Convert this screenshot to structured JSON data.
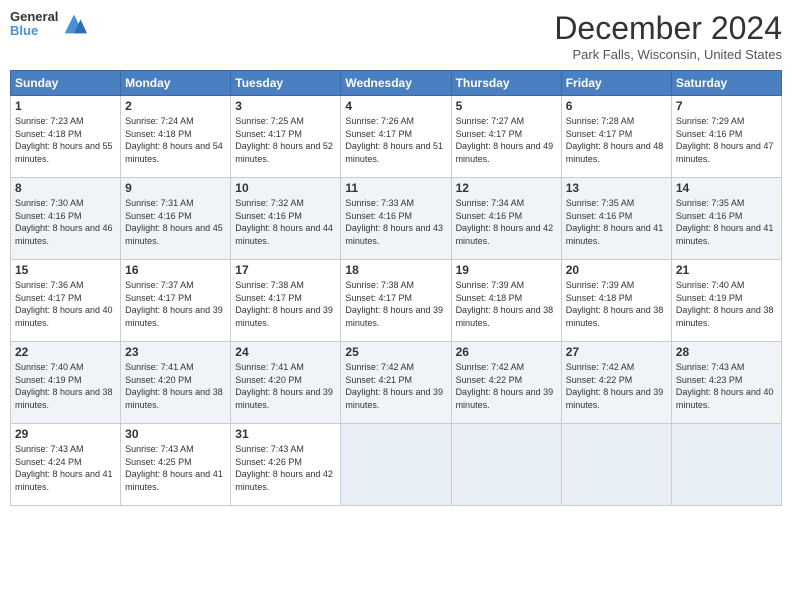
{
  "header": {
    "logo_line1": "General",
    "logo_line2": "Blue",
    "month": "December 2024",
    "location": "Park Falls, Wisconsin, United States"
  },
  "days_of_week": [
    "Sunday",
    "Monday",
    "Tuesday",
    "Wednesday",
    "Thursday",
    "Friday",
    "Saturday"
  ],
  "weeks": [
    [
      {
        "day": "1",
        "sunrise": "7:23 AM",
        "sunset": "4:18 PM",
        "daylight": "8 hours and 55 minutes."
      },
      {
        "day": "2",
        "sunrise": "7:24 AM",
        "sunset": "4:18 PM",
        "daylight": "8 hours and 54 minutes."
      },
      {
        "day": "3",
        "sunrise": "7:25 AM",
        "sunset": "4:17 PM",
        "daylight": "8 hours and 52 minutes."
      },
      {
        "day": "4",
        "sunrise": "7:26 AM",
        "sunset": "4:17 PM",
        "daylight": "8 hours and 51 minutes."
      },
      {
        "day": "5",
        "sunrise": "7:27 AM",
        "sunset": "4:17 PM",
        "daylight": "8 hours and 49 minutes."
      },
      {
        "day": "6",
        "sunrise": "7:28 AM",
        "sunset": "4:17 PM",
        "daylight": "8 hours and 48 minutes."
      },
      {
        "day": "7",
        "sunrise": "7:29 AM",
        "sunset": "4:16 PM",
        "daylight": "8 hours and 47 minutes."
      }
    ],
    [
      {
        "day": "8",
        "sunrise": "7:30 AM",
        "sunset": "4:16 PM",
        "daylight": "8 hours and 46 minutes."
      },
      {
        "day": "9",
        "sunrise": "7:31 AM",
        "sunset": "4:16 PM",
        "daylight": "8 hours and 45 minutes."
      },
      {
        "day": "10",
        "sunrise": "7:32 AM",
        "sunset": "4:16 PM",
        "daylight": "8 hours and 44 minutes."
      },
      {
        "day": "11",
        "sunrise": "7:33 AM",
        "sunset": "4:16 PM",
        "daylight": "8 hours and 43 minutes."
      },
      {
        "day": "12",
        "sunrise": "7:34 AM",
        "sunset": "4:16 PM",
        "daylight": "8 hours and 42 minutes."
      },
      {
        "day": "13",
        "sunrise": "7:35 AM",
        "sunset": "4:16 PM",
        "daylight": "8 hours and 41 minutes."
      },
      {
        "day": "14",
        "sunrise": "7:35 AM",
        "sunset": "4:16 PM",
        "daylight": "8 hours and 41 minutes."
      }
    ],
    [
      {
        "day": "15",
        "sunrise": "7:36 AM",
        "sunset": "4:17 PM",
        "daylight": "8 hours and 40 minutes."
      },
      {
        "day": "16",
        "sunrise": "7:37 AM",
        "sunset": "4:17 PM",
        "daylight": "8 hours and 39 minutes."
      },
      {
        "day": "17",
        "sunrise": "7:38 AM",
        "sunset": "4:17 PM",
        "daylight": "8 hours and 39 minutes."
      },
      {
        "day": "18",
        "sunrise": "7:38 AM",
        "sunset": "4:17 PM",
        "daylight": "8 hours and 39 minutes."
      },
      {
        "day": "19",
        "sunrise": "7:39 AM",
        "sunset": "4:18 PM",
        "daylight": "8 hours and 38 minutes."
      },
      {
        "day": "20",
        "sunrise": "7:39 AM",
        "sunset": "4:18 PM",
        "daylight": "8 hours and 38 minutes."
      },
      {
        "day": "21",
        "sunrise": "7:40 AM",
        "sunset": "4:19 PM",
        "daylight": "8 hours and 38 minutes."
      }
    ],
    [
      {
        "day": "22",
        "sunrise": "7:40 AM",
        "sunset": "4:19 PM",
        "daylight": "8 hours and 38 minutes."
      },
      {
        "day": "23",
        "sunrise": "7:41 AM",
        "sunset": "4:20 PM",
        "daylight": "8 hours and 38 minutes."
      },
      {
        "day": "24",
        "sunrise": "7:41 AM",
        "sunset": "4:20 PM",
        "daylight": "8 hours and 39 minutes."
      },
      {
        "day": "25",
        "sunrise": "7:42 AM",
        "sunset": "4:21 PM",
        "daylight": "8 hours and 39 minutes."
      },
      {
        "day": "26",
        "sunrise": "7:42 AM",
        "sunset": "4:22 PM",
        "daylight": "8 hours and 39 minutes."
      },
      {
        "day": "27",
        "sunrise": "7:42 AM",
        "sunset": "4:22 PM",
        "daylight": "8 hours and 39 minutes."
      },
      {
        "day": "28",
        "sunrise": "7:43 AM",
        "sunset": "4:23 PM",
        "daylight": "8 hours and 40 minutes."
      }
    ],
    [
      {
        "day": "29",
        "sunrise": "7:43 AM",
        "sunset": "4:24 PM",
        "daylight": "8 hours and 41 minutes."
      },
      {
        "day": "30",
        "sunrise": "7:43 AM",
        "sunset": "4:25 PM",
        "daylight": "8 hours and 41 minutes."
      },
      {
        "day": "31",
        "sunrise": "7:43 AM",
        "sunset": "4:26 PM",
        "daylight": "8 hours and 42 minutes."
      },
      null,
      null,
      null,
      null
    ]
  ],
  "labels": {
    "sunrise": "Sunrise:",
    "sunset": "Sunset:",
    "daylight": "Daylight:"
  }
}
